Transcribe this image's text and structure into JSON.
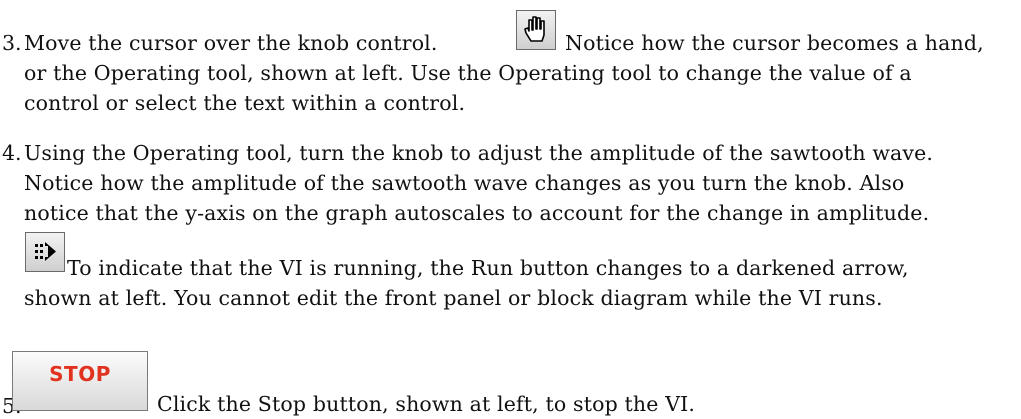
{
  "steps": [
    {
      "number": "3.",
      "lines": [
        "Move the cursor over the knob control.",
        "Notice how the cursor becomes a hand,",
        "or the Operating tool, shown at left. Use the Operating tool to change the value of a",
        "control or select the text within a control."
      ],
      "icon": "hand-cursor-icon"
    },
    {
      "number": "4.",
      "lines": [
        "Using the Operating tool, turn the knob to adjust the amplitude of the sawtooth wave.",
        "Notice how the amplitude of the sawtooth wave changes as you turn the knob. Also",
        "notice that the y-axis on the graph autoscales to account for the change in amplitude."
      ],
      "note_lines": [
        "To indicate that the VI is running, the Run button changes to a darkened arrow,",
        "shown at left. You cannot edit the front panel or block diagram while the VI runs."
      ],
      "icon": "run-arrow-icon"
    },
    {
      "number": "5.",
      "lines": [
        "Click the Stop button, shown at left, to stop the VI."
      ],
      "button_label": "STOP"
    }
  ]
}
